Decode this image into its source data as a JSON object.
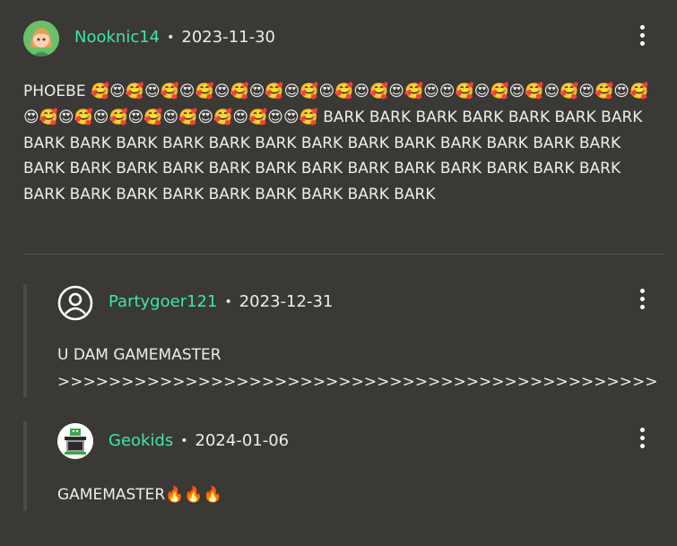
{
  "comments": [
    {
      "username": "Nooknic14",
      "date": "2023-11-30",
      "text": "PHOEBE 🥰😍🥰😍🥰😍🥰😍🥰😍🥰😍🥰😍🥰😍🥰😍🥰😍😍🥰😍🥰😍🥰😍🥰😍🥰😍🥰😍🥰😍🥰😍🥰😍🥰😍🥰😍🥰😍🥰😍😍🥰 BARK BARK BARK BARK BARK BARK BARK BARK BARK BARK BARK BARK BARK BARK BARK BARK BARK BARK BARK BARK BARK BARK BARK BARK BARK BARK BARK BARK BARK BARK BARK BARK BARK BARK BARK BARK BARK BARK BARK BARK BARK BARK"
    }
  ],
  "replies": [
    {
      "username": "Partygoer121",
      "date": "2023-12-31",
      "text_line1": "U DAM GAMEMASTER",
      "text_line2": ">>>>>>>>>>>>>>>>>>>>>>>>>>>>>>>>>>>>>>>>>>>>>>>>>>>>>>>>>>>>>>>>>>>>>> PHOEBE💜💚💙"
    },
    {
      "username": "Geokids",
      "date": "2024-01-06",
      "text": "GAMEMASTER🔥🔥🔥"
    }
  ],
  "separator": "•",
  "icons": {
    "avatar_1": "anime-avatar-icon",
    "avatar_2": "default-user-icon",
    "avatar_3": "pixel-robot-avatar-icon",
    "more": "more-vertical-icon"
  },
  "colors": {
    "background": "#3a3935",
    "username": "#3ee6a8",
    "text": "#ededed"
  }
}
